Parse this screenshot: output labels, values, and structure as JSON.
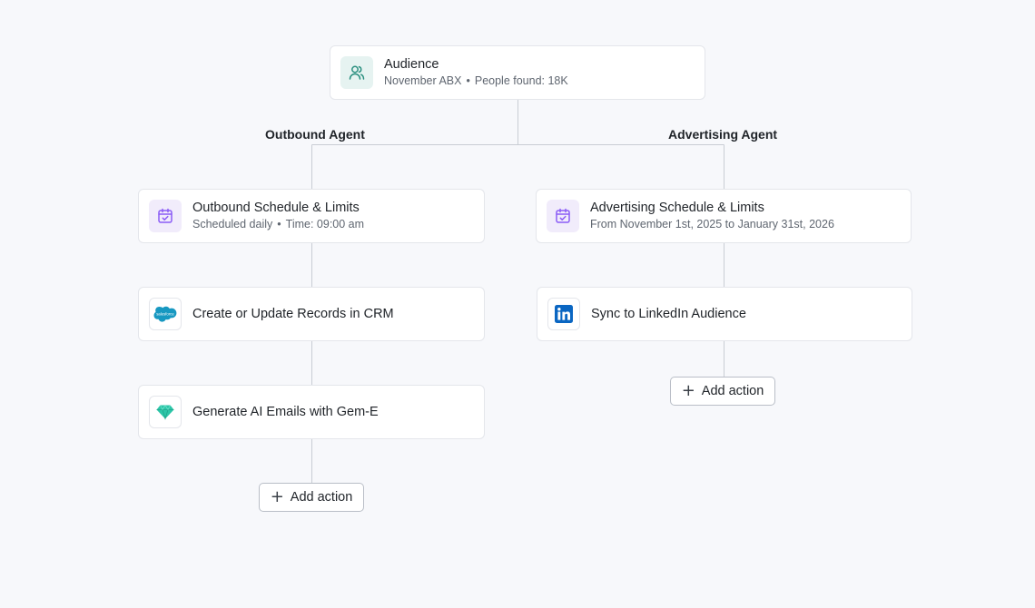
{
  "audience": {
    "title": "Audience",
    "list_name": "November ABX",
    "separator": "•",
    "people_found": "People found: 18K",
    "icon": "users-icon"
  },
  "outbound": {
    "agent_label": "Outbound Agent",
    "schedule": {
      "title": "Outbound Schedule & Limits",
      "frequency": "Scheduled daily",
      "separator": "•",
      "time": "Time: 09:00 am",
      "icon": "calendar-check-icon"
    },
    "actions": [
      {
        "title": "Create or Update Records in CRM",
        "icon": "salesforce-icon",
        "logo_text": "salesforce"
      },
      {
        "title": "Generate AI Emails with Gem-E",
        "icon": "gem-icon"
      }
    ],
    "add_action_label": "Add action"
  },
  "advertising": {
    "agent_label": "Advertising Agent",
    "schedule": {
      "title": "Advertising Schedule & Limits",
      "range": "From November 1st, 2025 to January 31st, 2026",
      "icon": "calendar-check-icon"
    },
    "actions": [
      {
        "title": "Sync to LinkedIn Audience",
        "icon": "linkedin-icon",
        "logo_text": "in"
      }
    ],
    "add_action_label": "Add action"
  },
  "colors": {
    "background": "#f7f8fb",
    "connector": "#c9cdd4",
    "teal_icon": "#2a8f7f",
    "purple_icon": "#8b5cf6",
    "salesforce": "#1798c1",
    "linkedin": "#0a66c2",
    "gem": "#2cc6a8"
  }
}
